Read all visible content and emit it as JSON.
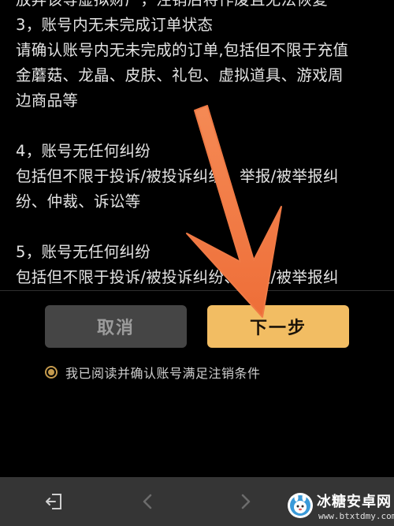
{
  "terms": {
    "lines": [
      "放弃该等虚拟财产，注销后将作废且无法恢复",
      "3，账号内无未完成订单状态",
      "请确认账号内无未完成的订单,包括但不限于充值",
      "金蘑菇、龙晶、皮肤、礼包、虚拟道具、游戏周",
      "边商品等",
      "4，账号无任何纠纷",
      "包括但不限于投诉/被投诉纠纷、举报/被举报纠",
      "纷、仲裁、诉讼等",
      "5，账号无任何纠纷",
      "包括但不限于投诉/被投诉纠纷、举报/被举报纠"
    ]
  },
  "buttons": {
    "cancel_label": "取消",
    "next_label": "下一步"
  },
  "agreement": {
    "text": "我已阅读并确认账号满足注销条件",
    "checked": true
  },
  "navbar": {
    "icons": [
      "exit-icon",
      "back-arrow-icon",
      "forward-arrow-icon"
    ]
  },
  "watermark": {
    "title": "冰糖安卓网",
    "url": "www.btxtdmy.com"
  },
  "colors": {
    "accent": "#f2bd63",
    "arrow": "#f07a45",
    "background": "#000000",
    "navbar": "#353535"
  }
}
